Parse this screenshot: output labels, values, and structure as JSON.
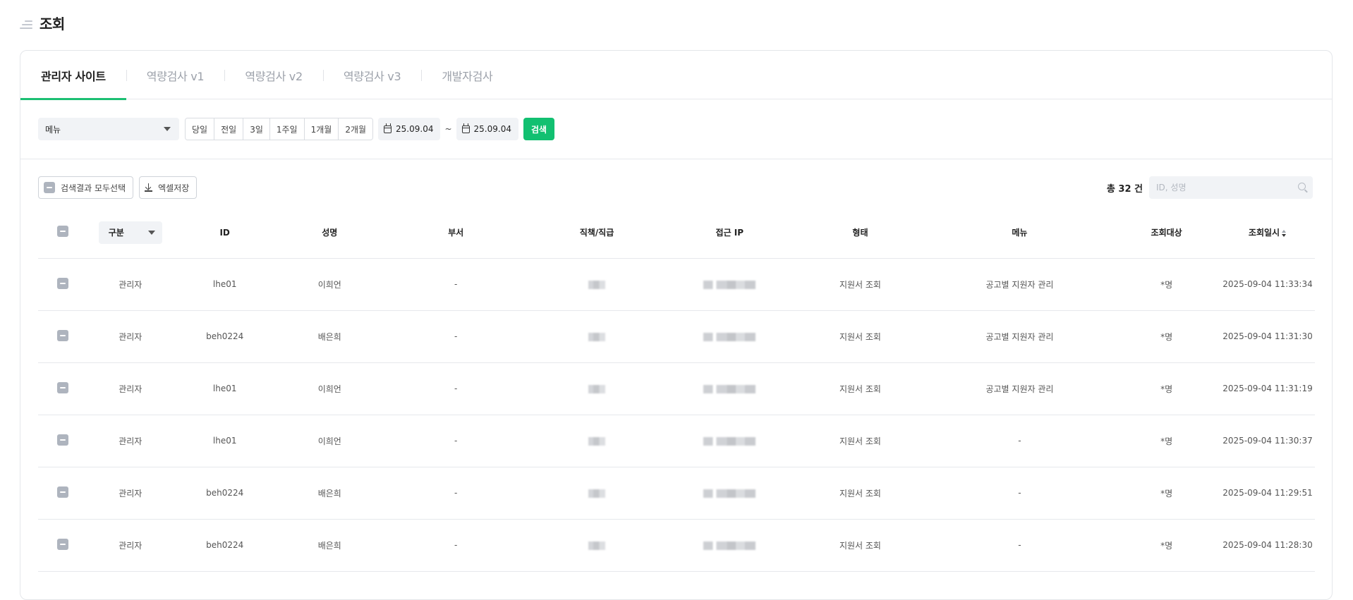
{
  "page": {
    "title": "조회"
  },
  "tabs": [
    {
      "label": "관리자 사이트",
      "active": true
    },
    {
      "label": "역량검사 v1",
      "active": false
    },
    {
      "label": "역량검사 v2",
      "active": false
    },
    {
      "label": "역량검사 v3",
      "active": false
    },
    {
      "label": "개발자검사",
      "active": false
    }
  ],
  "filters": {
    "menu_select": "메뉴",
    "periods": [
      "당일",
      "전일",
      "3일",
      "1주일",
      "1개월",
      "2개월"
    ],
    "date_from": "25.09.04",
    "date_separator": "~",
    "date_to": "25.09.04",
    "search_label": "검색"
  },
  "actions": {
    "select_all_label": "검색결과 모두선택",
    "excel_label": "엑셀저장"
  },
  "summary": {
    "total_label": "총 32 건",
    "search_placeholder": "ID, 성명"
  },
  "table": {
    "type_select_label": "구분",
    "columns": [
      "구분",
      "ID",
      "성명",
      "부서",
      "직책/직급",
      "접근 IP",
      "형태",
      "메뉴",
      "조회대상",
      "조회일시"
    ],
    "rows": [
      {
        "type": "관리자",
        "id": "lhe01",
        "name": "이희언",
        "dept": "-",
        "form": "지원서 조회",
        "menu": "공고별 지원자 관리",
        "target": "*명",
        "datetime": "2025-09-04 11:33:34"
      },
      {
        "type": "관리자",
        "id": "beh0224",
        "name": "배은희",
        "dept": "-",
        "form": "지원서 조회",
        "menu": "공고별 지원자 관리",
        "target": "*명",
        "datetime": "2025-09-04 11:31:30"
      },
      {
        "type": "관리자",
        "id": "lhe01",
        "name": "이희언",
        "dept": "-",
        "form": "지원서 조회",
        "menu": "공고별 지원자 관리",
        "target": "*명",
        "datetime": "2025-09-04 11:31:19"
      },
      {
        "type": "관리자",
        "id": "lhe01",
        "name": "이희언",
        "dept": "-",
        "form": "지원서 조회",
        "menu": "-",
        "target": "*명",
        "datetime": "2025-09-04 11:30:37"
      },
      {
        "type": "관리자",
        "id": "beh0224",
        "name": "배은희",
        "dept": "-",
        "form": "지원서 조회",
        "menu": "-",
        "target": "*명",
        "datetime": "2025-09-04 11:29:51"
      },
      {
        "type": "관리자",
        "id": "beh0224",
        "name": "배은희",
        "dept": "-",
        "form": "지원서 조회",
        "menu": "-",
        "target": "*명",
        "datetime": "2025-09-04 11:28:30"
      }
    ]
  },
  "colors": {
    "accent": "#12c071",
    "tab_active": "#1cbf73",
    "checkbox": "#aeb4be"
  },
  "icons": [
    "menu-icon",
    "chevron-down-icon",
    "calendar-icon",
    "download-icon",
    "search-icon",
    "sort-icon"
  ]
}
